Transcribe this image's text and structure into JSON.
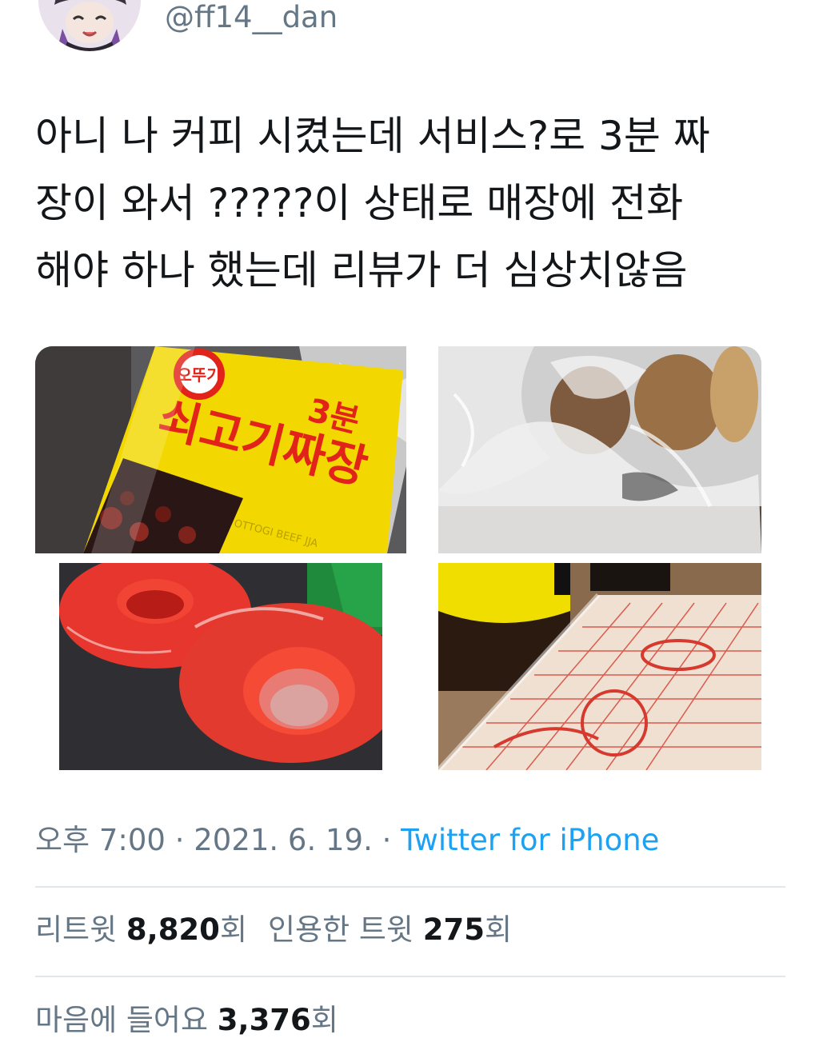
{
  "author": {
    "handle": "@ff14__dan"
  },
  "tweet": {
    "text": "아니 나 커피 시켰는데 서비스?로 3분 짜\n장이 와서 ?????이 상태로 매장에 전화\n해야 하나 했는데 리뷰가 더 심상치않음"
  },
  "media": [
    {
      "description_icon": "photo-icon",
      "package_text_1": "쇠고기짜장",
      "package_text_2": "3분",
      "package_text_3": "OTTOGI BEEF JJA"
    },
    {
      "description_icon": "photo-icon"
    },
    {
      "description_icon": "photo-icon"
    },
    {
      "description_icon": "photo-icon"
    }
  ],
  "meta": {
    "time": "오후 7:00",
    "separator1": " · ",
    "date": "2021. 6. 19.",
    "separator2": " · ",
    "source": "Twitter for iPhone"
  },
  "stats": {
    "retweets_label": "리트윗 ",
    "retweets_count": "8,820",
    "retweets_unit": "회",
    "quotes_label": "인용한 트윗 ",
    "quotes_count": "275",
    "quotes_unit": "회",
    "likes_label": "마음에 들어요 ",
    "likes_count": "3,376",
    "likes_unit": "회"
  },
  "colors": {
    "link": "#1da1f2",
    "secondary_text": "#657786",
    "primary_text": "#14171a",
    "divider": "#e1e8ed"
  }
}
